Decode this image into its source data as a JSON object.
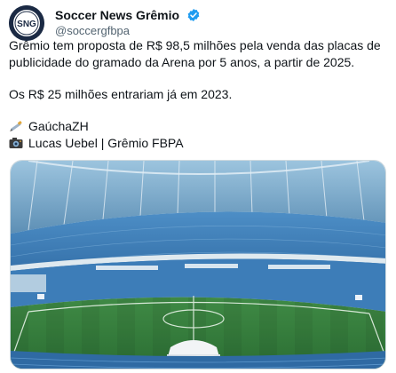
{
  "author": {
    "display_name": "Soccer News Grêmio",
    "handle": "@soccergfbpa",
    "avatar_text": "SNG"
  },
  "tweet": {
    "line1": "Grêmio tem proposta de R$ 98,5 milhões pela venda das placas de",
    "line2": "publicidade do gramado da Arena por 5 anos, a partir de 2025.",
    "line3": "Os R$ 25 milhões entrariam já em 2023.",
    "credit_source": "GaúchaZH",
    "credit_photo": "Lucas Uebel | Grêmio FBPA"
  },
  "icons": {
    "verified": "verified-badge-icon",
    "source": "pen-icon",
    "photo": "camera-icon"
  },
  "colors": {
    "verified_blue": "#1d9bf0",
    "text": "#0f1419",
    "secondary": "#536471",
    "seats": "#3a7fc0",
    "pitch": "#2f7a3a"
  }
}
